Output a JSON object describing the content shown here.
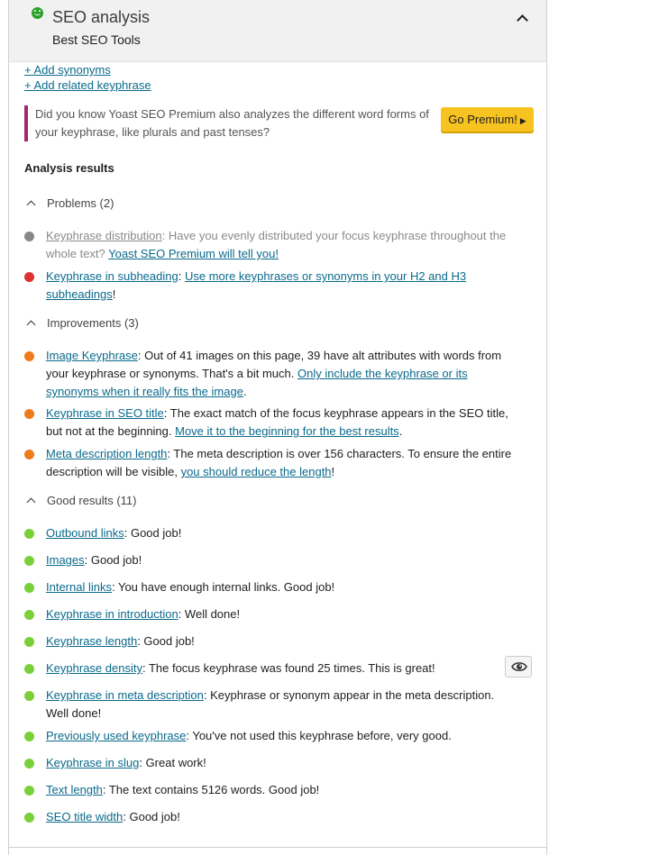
{
  "header": {
    "title": "SEO analysis",
    "subtitle": "Best SEO Tools",
    "score_icon": "smiley-good-icon",
    "collapse_icon": "chevron-up-icon"
  },
  "links": {
    "add_synonyms": "+ Add synonyms",
    "add_related": "+ Add related keyphrase"
  },
  "notice": {
    "text": "Did you know Yoast SEO Premium also analyzes the different word forms of your keyphrase, like plurals and past tenses?",
    "button_label": "Go Premium!",
    "button_icon": "▶"
  },
  "analysis": {
    "heading": "Analysis results",
    "groups": [
      {
        "label": "Problems (2)",
        "items": [
          {
            "status": "disabled",
            "color": "#888888",
            "link": "Keyphrase distribution",
            "text": ": Have you evenly distributed your focus keyphrase throughout the whole text? ",
            "link2": "Yoast SEO Premium will tell you!",
            "tail": ""
          },
          {
            "status": "bad",
            "color": "#dc3232",
            "link": "Keyphrase in subheading",
            "text": ": ",
            "link2": "Use more keyphrases or synonyms in your H2 and H3 subheadings",
            "tail": "!"
          }
        ]
      },
      {
        "label": "Improvements (3)",
        "items": [
          {
            "status": "ok",
            "color": "#ee7c1b",
            "link": "Image Keyphrase",
            "text": ": Out of 41 images on this page, 39 have alt attributes with words from your keyphrase or synonyms. That's a bit much. ",
            "link2": "Only include the keyphrase or its synonyms when it really fits the image",
            "tail": "."
          },
          {
            "status": "ok",
            "color": "#ee7c1b",
            "link": "Keyphrase in SEO title",
            "text": ": The exact match of the focus keyphrase appears in the SEO title, but not at the beginning. ",
            "link2": "Move it to the beginning for the best results",
            "tail": "."
          },
          {
            "status": "ok",
            "color": "#ee7c1b",
            "link": "Meta description length",
            "text": ": The meta description is over 156 characters. To ensure the entire description will be visible, ",
            "link2": "you should reduce the length",
            "tail": "!"
          }
        ]
      },
      {
        "label": "Good results (11)",
        "items": [
          {
            "status": "good",
            "color": "#7ad03a",
            "link": "Outbound links",
            "text": ": Good job!"
          },
          {
            "status": "good",
            "color": "#7ad03a",
            "link": "Images",
            "text": ": Good job!"
          },
          {
            "status": "good",
            "color": "#7ad03a",
            "link": "Internal links",
            "text": ": You have enough internal links. Good job!"
          },
          {
            "status": "good",
            "color": "#7ad03a",
            "link": "Keyphrase in introduction",
            "text": ": Well done!"
          },
          {
            "status": "good",
            "color": "#7ad03a",
            "link": "Keyphrase length",
            "text": ": Good job!"
          },
          {
            "status": "good",
            "color": "#7ad03a",
            "link": "Keyphrase density",
            "text": ": The focus keyphrase was found 25 times. This is great!",
            "action_icon": "eye-icon"
          },
          {
            "status": "good",
            "color": "#7ad03a",
            "link": "Keyphrase in meta description",
            "text": ": Keyphrase or synonym appear in the meta description. Well done!"
          },
          {
            "status": "good",
            "color": "#7ad03a",
            "link": "Previously used keyphrase",
            "text": ": You've not used this keyphrase before, very good."
          },
          {
            "status": "good",
            "color": "#7ad03a",
            "link": "Keyphrase in slug",
            "text": ": Great work!"
          },
          {
            "status": "good",
            "color": "#7ad03a",
            "link": "Text length",
            "text": ": The text contains 5126 words. Good job!"
          },
          {
            "status": "good",
            "color": "#7ad03a",
            "link": "SEO title width",
            "text": ": Good job!"
          }
        ]
      }
    ]
  }
}
